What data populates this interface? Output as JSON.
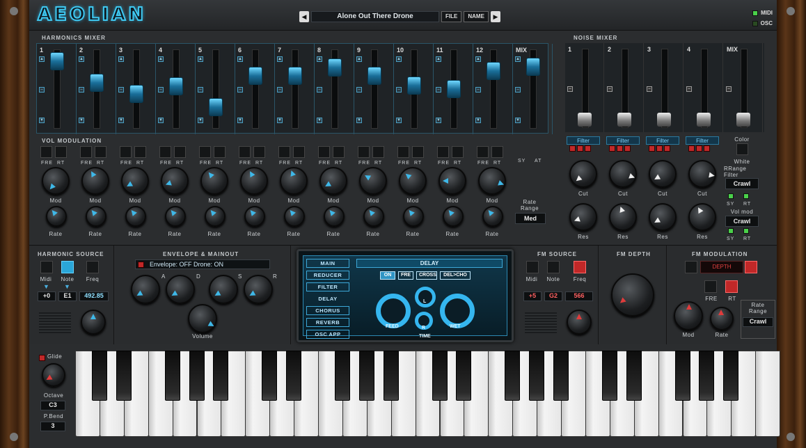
{
  "header": {
    "logo": "AEOLIAN",
    "preset_name": "Alone Out There Drone",
    "file_label": "FILE",
    "name_label": "NAME",
    "midi_label": "MIDI",
    "osc_label": "OSC",
    "prev_icon": "triangle-left",
    "next_icon": "triangle-right"
  },
  "harmonics_mixer": {
    "title": "HARMONICS MIXER",
    "channels": [
      "1",
      "2",
      "3",
      "4",
      "5",
      "6",
      "7",
      "8",
      "9",
      "10",
      "11",
      "12",
      "MIX"
    ],
    "levels": [
      0.95,
      0.6,
      0.42,
      0.55,
      0.2,
      0.72,
      0.72,
      0.85,
      0.72,
      0.56,
      0.5,
      0.8,
      0.86
    ]
  },
  "noise_mixer": {
    "title": "NOISE MIXER",
    "channels": [
      "1",
      "2",
      "3",
      "4",
      "MIX"
    ],
    "levels": [
      0.08,
      0.08,
      0.08,
      0.08,
      0.08
    ]
  },
  "vol_modulation": {
    "title": "VOL MODULATION",
    "fre": "FRE",
    "rt": "RT",
    "mod": "Mod",
    "rate": "Rate",
    "sy": "SY",
    "at": "AT",
    "rate_range_label": "Rate\nRange",
    "rate_range_value": "Med"
  },
  "noise_filters": {
    "filter_label": "Filter",
    "cut": "Cut",
    "res": "Res",
    "color_label": "Color",
    "color_value": "White",
    "rrange_label": "RRange\nFilter",
    "rrange_value": "Crawl",
    "sy": "SY",
    "rt": "RT",
    "volmod_label": "Vol mod",
    "volmod_value": "Crawl"
  },
  "harmonic_source": {
    "title": "HARMONIC SOURCE",
    "midi": "Midi",
    "note": "Note",
    "freq": "Freq",
    "midi_value": "+0",
    "note_value": "E1",
    "freq_value": "492.85"
  },
  "envelope": {
    "title": "ENVELOPE & MAINOUT",
    "status": "Envelope: OFF   Drone: ON",
    "a": "A",
    "d": "D",
    "s": "S",
    "r": "R",
    "volume": "Volume"
  },
  "screen": {
    "menu": [
      "MAIN",
      "REDUCER",
      "FILTER",
      "DELAY",
      "CHORUS",
      "REVERB",
      "OSC APP"
    ],
    "header": "DELAY",
    "buttons": [
      "ON",
      "FRE",
      "CROSS",
      "DEL>CHO"
    ],
    "feed": "FEED",
    "time": "TIME",
    "wet": "WET",
    "l": "L",
    "r": "R"
  },
  "fm_source": {
    "title": "FM SOURCE",
    "midi": "Midi",
    "note": "Note",
    "freq": "Freq",
    "midi_value": "+5",
    "note_value": "G2",
    "freq_value": "566"
  },
  "fm_depth": {
    "title": "FM DEPTH"
  },
  "fm_modulation": {
    "title": "FM MODULATION",
    "depth_label": "DEPTH",
    "fre": "FRE",
    "rt": "RT",
    "mod": "Mod",
    "rate": "Rate",
    "rate_range_label": "Rate\nRange",
    "rate_range_value": "Crawl"
  },
  "keyboard": {
    "glide_label": "Glide",
    "octave_label": "Octave",
    "octave_value": "C3",
    "pbend_label": "P.Bend",
    "pbend_value": "3"
  },
  "colors": {
    "accent": "#35b6ef",
    "red": "#c12828",
    "panel": "#2b2d2f"
  }
}
